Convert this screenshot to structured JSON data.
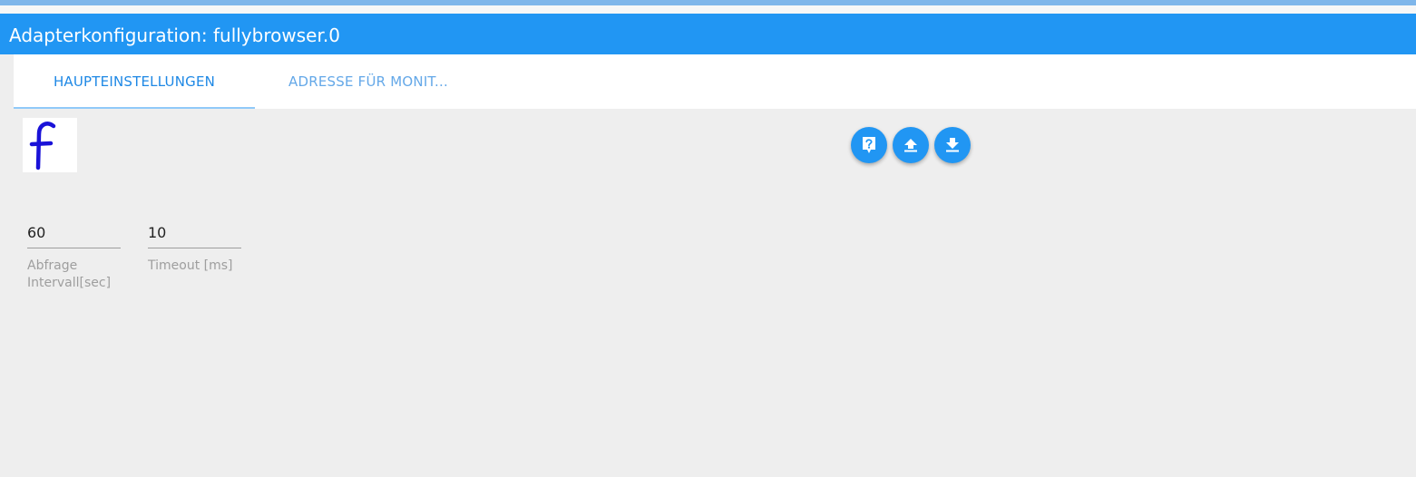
{
  "header": {
    "title": "Adapterkonfiguration: fullybrowser.0",
    "color": "#2196f3"
  },
  "tabs": [
    {
      "label": "HAUPTEINSTELLUNGEN",
      "active": true
    },
    {
      "label": "ADRESSE FÜR MONIT...",
      "active": false
    }
  ],
  "logo": {
    "letter": "f",
    "color": "#1a12d8"
  },
  "toolbar": {
    "buttons": [
      {
        "icon": "help-icon"
      },
      {
        "icon": "upload-icon"
      },
      {
        "icon": "download-icon"
      }
    ]
  },
  "fields": {
    "interval": {
      "value": "60",
      "label_line1": "Abfrage",
      "label_line2": "Intervall[sec]"
    },
    "timeout": {
      "value": "10",
      "label": "Timeout [ms]"
    }
  }
}
